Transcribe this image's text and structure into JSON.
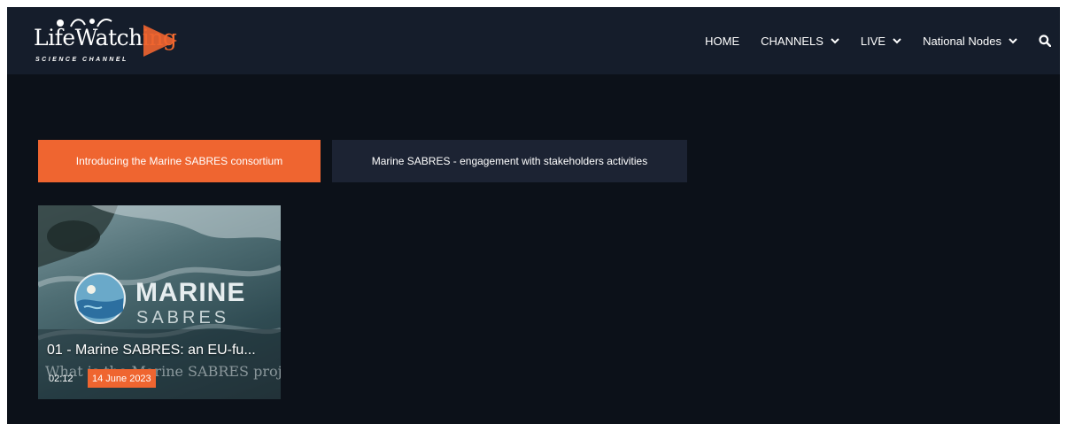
{
  "brand": {
    "logo_word": "LifeWatch",
    "logo_suffix": "ing",
    "logo_subtitle": "SCIENCE CHANNEL",
    "accent_color": "#ef6530"
  },
  "nav": {
    "items": [
      {
        "label": "HOME",
        "has_dropdown": false
      },
      {
        "label": "CHANNELS",
        "has_dropdown": true
      },
      {
        "label": "LIVE",
        "has_dropdown": true
      },
      {
        "label": "National Nodes",
        "has_dropdown": true
      }
    ],
    "search_icon": "search-icon"
  },
  "tabs": [
    {
      "label": "Introducing the Marine SABRES consortium",
      "active": true
    },
    {
      "label": "Marine SABRES - engagement with stakeholders activities",
      "active": false
    }
  ],
  "videos": [
    {
      "thumbnail_title_1": "MARINE",
      "thumbnail_title_2": "SABRES",
      "thumbnail_subtitle": "What is the Marine SABRES project?",
      "title": "01 - Marine SABRES: an EU-fu...",
      "duration": "02:12",
      "date": "14 June 2023"
    }
  ]
}
